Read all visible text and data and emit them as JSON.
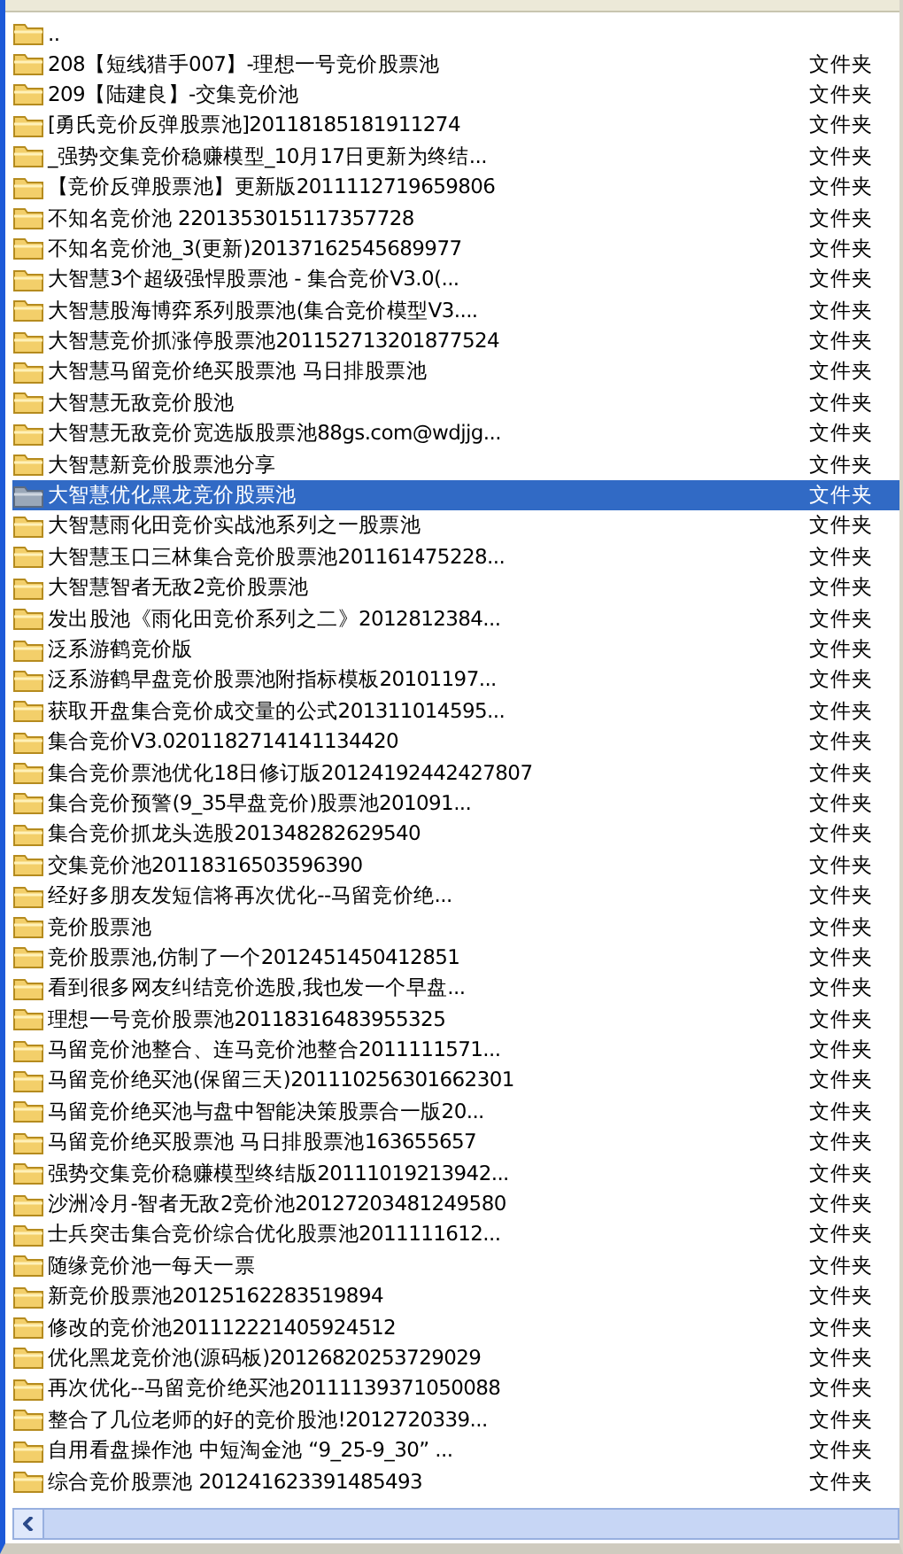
{
  "files": [
    {
      "name": "..",
      "selected": false
    },
    {
      "name": "208【短线猎手007】-理想一号竞价股票池",
      "type": "文件夹",
      "selected": false
    },
    {
      "name": "209【陆建良】-交集竞价池",
      "type": "文件夹",
      "selected": false
    },
    {
      "name": "[勇氏竞价反弹股票池]20118185181911274",
      "type": "文件夹",
      "selected": false
    },
    {
      "name": "_强势交集竞价稳赚模型_10月17日更新为终结...",
      "type": "文件夹",
      "selected": false
    },
    {
      "name": "【竞价反弹股票池】更新版2011112719659806",
      "type": "文件夹",
      "selected": false
    },
    {
      "name": "不知名竞价池 2201353015117357728",
      "type": "文件夹",
      "selected": false
    },
    {
      "name": "不知名竞价池_3(更新)20137162545689977",
      "type": "文件夹",
      "selected": false
    },
    {
      "name": "大智慧3个超级强悍股票池 - 集合竞价V3.0(...",
      "type": "文件夹",
      "selected": false
    },
    {
      "name": "大智慧股海博弈系列股票池(集合竞价模型V3....",
      "type": "文件夹",
      "selected": false
    },
    {
      "name": "大智慧竞价抓涨停股票池201152713201877524",
      "type": "文件夹",
      "selected": false
    },
    {
      "name": "大智慧马留竞价绝买股票池 马日排股票池",
      "type": "文件夹",
      "selected": false
    },
    {
      "name": "大智慧无敌竞价股池",
      "type": "文件夹",
      "selected": false
    },
    {
      "name": "大智慧无敌竞价宽选版股票池88gs.com@wdjjg...",
      "type": "文件夹",
      "selected": false
    },
    {
      "name": "大智慧新竞价股票池分享",
      "type": "文件夹",
      "selected": false
    },
    {
      "name": "大智慧优化黑龙竞价股票池",
      "type": "文件夹",
      "selected": true
    },
    {
      "name": "大智慧雨化田竞价实战池系列之一股票池",
      "type": "文件夹",
      "selected": false
    },
    {
      "name": "大智慧玉口三林集合竞价股票池201161475228...",
      "type": "文件夹",
      "selected": false
    },
    {
      "name": "大智慧智者无敌2竞价股票池",
      "type": "文件夹",
      "selected": false
    },
    {
      "name": "发出股池《雨化田竞价系列之二》2012812384...",
      "type": "文件夹",
      "selected": false
    },
    {
      "name": "泛系游鹤竞价版",
      "type": "文件夹",
      "selected": false
    },
    {
      "name": "泛系游鹤早盘竞价股票池附指标模板20101197...",
      "type": "文件夹",
      "selected": false
    },
    {
      "name": "获取开盘集合竞价成交量的公式201311014595...",
      "type": "文件夹",
      "selected": false
    },
    {
      "name": "集合竞价V3.0201182714141134420",
      "type": "文件夹",
      "selected": false
    },
    {
      "name": "集合竞价票池优化18日修订版20124192442427807",
      "type": "文件夹",
      "selected": false
    },
    {
      "name": "集合竞价预警(9_35早盘竞价)股票池201091...",
      "type": "文件夹",
      "selected": false
    },
    {
      "name": "集合竞价抓龙头选股201348282629540",
      "type": "文件夹",
      "selected": false
    },
    {
      "name": "交集竞价池20118316503596390",
      "type": "文件夹",
      "selected": false
    },
    {
      "name": "经好多朋友发短信将再次优化--马留竞价绝...",
      "type": "文件夹",
      "selected": false
    },
    {
      "name": "竞价股票池",
      "type": "文件夹",
      "selected": false
    },
    {
      "name": "竞价股票池,仿制了一个2012451450412851",
      "type": "文件夹",
      "selected": false
    },
    {
      "name": "看到很多网友纠结竞价选股,我也发一个早盘...",
      "type": "文件夹",
      "selected": false
    },
    {
      "name": "理想一号竞价股票池20118316483955325",
      "type": "文件夹",
      "selected": false
    },
    {
      "name": "马留竞价池整合、连马竞价池整合2011111571...",
      "type": "文件夹",
      "selected": false
    },
    {
      "name": "马留竞价绝买池(保留三天)201110256301662301",
      "type": "文件夹",
      "selected": false
    },
    {
      "name": "马留竞价绝买池与盘中智能决策股票合一版20...",
      "type": "文件夹",
      "selected": false
    },
    {
      "name": "马留竞价绝买股票池 马日排股票池163655657",
      "type": "文件夹",
      "selected": false
    },
    {
      "name": "强势交集竞价稳赚模型终结版20111019213942...",
      "type": "文件夹",
      "selected": false
    },
    {
      "name": "沙洲冷月-智者无敌2竞价池20127203481249580",
      "type": "文件夹",
      "selected": false
    },
    {
      "name": "士兵突击集合竞价综合优化股票池2011111612...",
      "type": "文件夹",
      "selected": false
    },
    {
      "name": "随缘竞价池一每天一票",
      "type": "文件夹",
      "selected": false
    },
    {
      "name": "新竞价股票池20125162283519894",
      "type": "文件夹",
      "selected": false
    },
    {
      "name": "修改的竞价池201112221405924512",
      "type": "文件夹",
      "selected": false
    },
    {
      "name": "优化黑龙竞价池(源码板)20126820253729029",
      "type": "文件夹",
      "selected": false
    },
    {
      "name": "再次优化--马留竞价绝买池20111139371050088",
      "type": "文件夹",
      "selected": false
    },
    {
      "name": "整合了几位老师的好的竞价股池!2012720339...",
      "type": "文件夹",
      "selected": false
    },
    {
      "name": "自用看盘操作池 中短淘金池 “9_25-9_30” ...",
      "type": "文件夹",
      "selected": false
    },
    {
      "name": "综合竞价股票池 201241623391485493",
      "type": "文件夹",
      "selected": false
    }
  ]
}
